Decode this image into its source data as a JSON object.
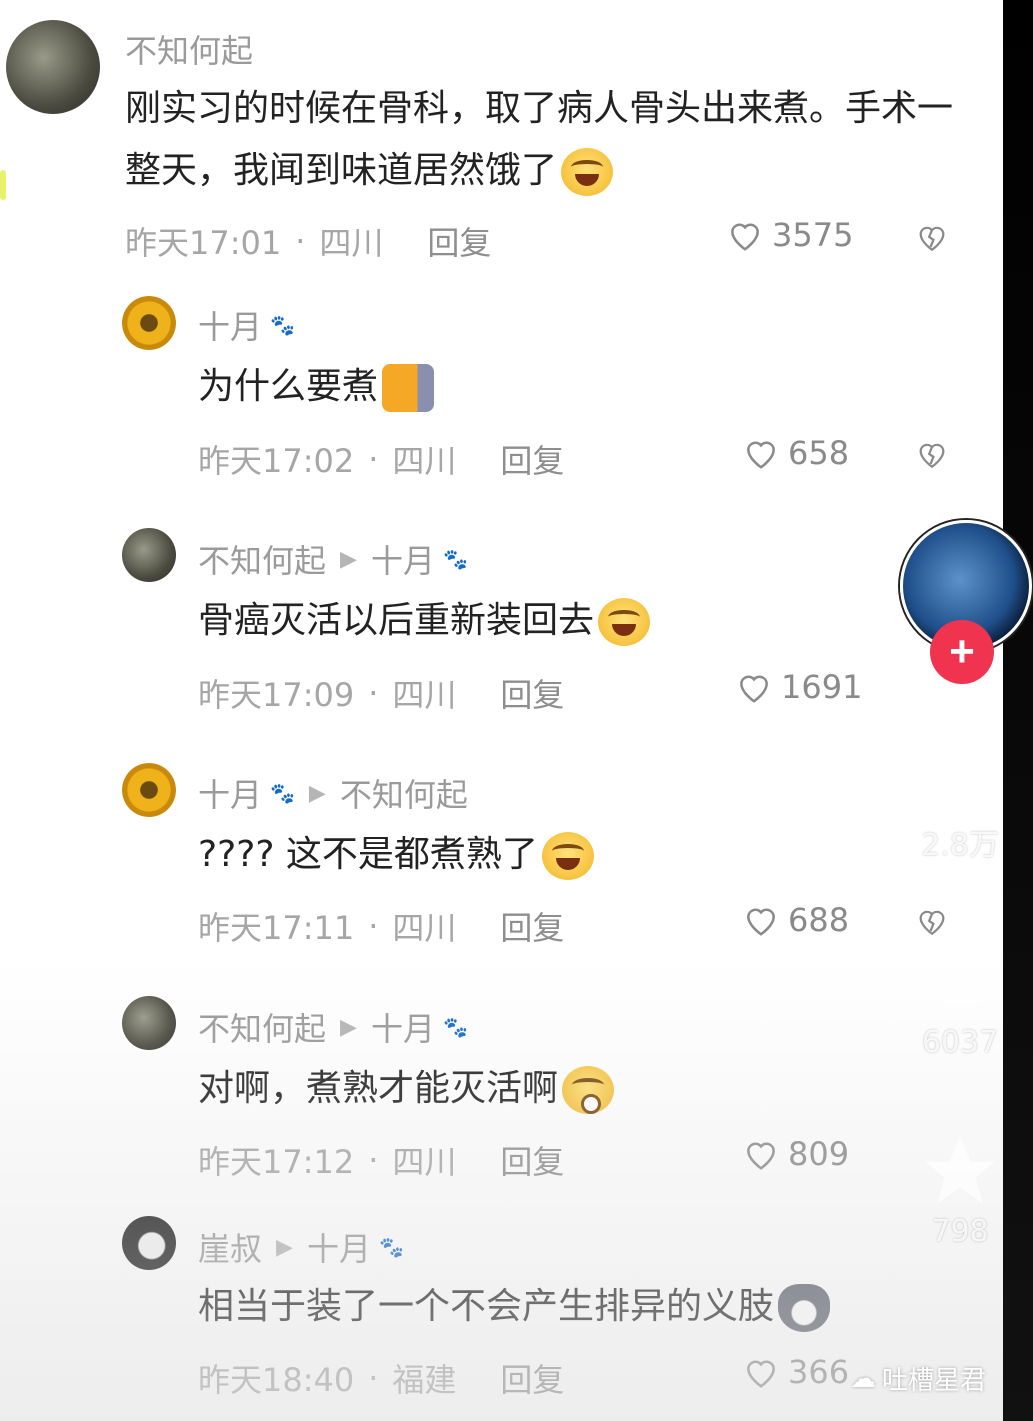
{
  "comments": [
    {
      "user": "不知何起",
      "reply_to": "",
      "text": "刚实习的时候在骨科，取了病人骨头出来煮。手术一整天，我闻到味道居然饿了",
      "emoji": "laugh-cry-emoji",
      "time": "昨天17:01",
      "location": "四川",
      "reply_label": "回复",
      "likes": "3575"
    },
    {
      "user": "十月",
      "reply_to": "",
      "text": "为什么要煮",
      "emoji": "peeking-cat-emoji",
      "time": "昨天17:02",
      "location": "四川",
      "reply_label": "回复",
      "likes": "658"
    },
    {
      "user": "不知何起",
      "reply_to": "十月",
      "text": "骨癌灭活以后重新装回去",
      "emoji": "laugh-cry-emoji",
      "time": "昨天17:09",
      "location": "四川",
      "reply_label": "回复",
      "likes": "1691"
    },
    {
      "user": "十月",
      "reply_to": "不知何起",
      "text": "???? 这不是都煮熟了",
      "emoji": "laugh-cry-emoji",
      "time": "昨天17:11",
      "location": "四川",
      "reply_label": "回复",
      "likes": "688"
    },
    {
      "user": "不知何起",
      "reply_to": "十月",
      "text": "对啊，煮熟才能灭活啊",
      "emoji": "shocked-emoji",
      "time": "昨天17:12",
      "location": "四川",
      "reply_label": "回复",
      "likes": "809"
    },
    {
      "user": "崖叔",
      "reply_to": "十月",
      "text": "相当于装了一个不会产生排异的义肢",
      "emoji": "husky-emoji",
      "time": "昨天18:40",
      "location": "福建",
      "reply_label": "回复",
      "likes": "366"
    }
  ],
  "side_panel": {
    "like_count": "2.8万",
    "comment_count": "6037",
    "favorite_count": "798"
  },
  "watermark": "吐槽星君",
  "colors": {
    "follow_button": "#f0334f",
    "meta_text": "#a6a6a6"
  }
}
